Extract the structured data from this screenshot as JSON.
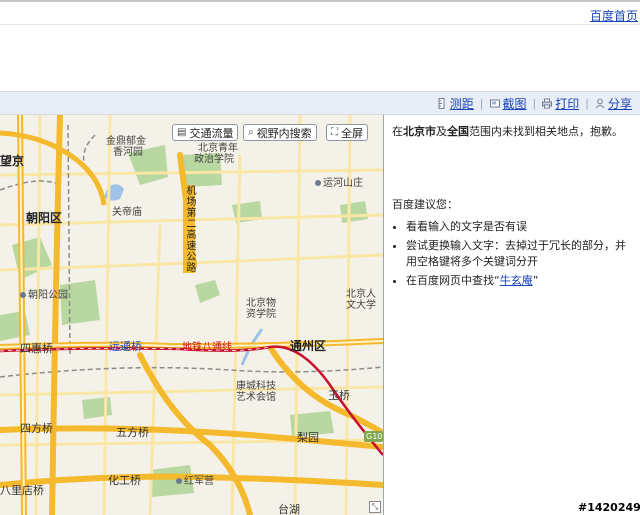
{
  "header": {
    "top_link": "百度首页"
  },
  "toolbar": {
    "items": [
      {
        "label": "测距",
        "icon": "ruler-icon"
      },
      {
        "label": "截图",
        "icon": "screenshot-icon"
      },
      {
        "label": "打印",
        "icon": "printer-icon"
      },
      {
        "label": "分享",
        "icon": "share-icon"
      }
    ],
    "separator": "|"
  },
  "map": {
    "buttons": [
      {
        "label": "交通流量",
        "icon": "traffic-icon"
      },
      {
        "label": "视野内搜索",
        "icon": "search-icon"
      },
      {
        "label": "全屏",
        "icon": "fullscreen-icon"
      }
    ],
    "labels": {
      "jing": "望京",
      "jinding": "金鼎郁金",
      "xiangheyuan": "香河园",
      "beijing_qingnian": "北京青年",
      "zhengzhi": "政治学院",
      "chaoyang": "朝阳区",
      "guandimiao": "关帝庙",
      "airport_expwy": "机场第二高速公路",
      "yunhe": "运河山庄",
      "chaoyang_park": "朝阳公园",
      "wuzi_1": "北京物",
      "wuzi_2": "资学院",
      "renmin_1": "北京人",
      "renmin_2": "文大学",
      "sihuiqiao": "四惠桥",
      "yuanyuanqiao": "远通桥",
      "batong": "地铁八通线",
      "tongzhou": "通州区",
      "kangcheng_1": "康城科技",
      "kangcheng_2": "艺术会馆",
      "yuqiao": "玉桥",
      "sifangqiao": "四方桥",
      "wufangqiao": "五方桥",
      "liyuan": "梨园",
      "huagongqiao": "化工桥",
      "hongjunying": "红军营",
      "balizhuang": "八里店桥",
      "taihu": "台湖",
      "g103": "G103"
    }
  },
  "results": {
    "not_found_pre": "在",
    "not_found_city": "北京市",
    "not_found_mid": "及",
    "not_found_scope": "全国",
    "not_found_post": "范围内未找到相关地点，抱歉。",
    "suggest_title": "百度建议您：",
    "suggestions": [
      "看看输入的文字是否有误",
      "尝试更换输入文字：去掉过于冗长的部分，并用空格键将多个关键词分开",
      "在百度网页中查找"
    ],
    "search_term": "牛玄庵",
    "quote_open": "“",
    "quote_close": "”"
  },
  "watermark": "#1420249",
  "colors": {
    "link": "#1a44b8",
    "highway": "#f4b92c",
    "road": "#fbe7a5",
    "park": "#b9d7a0",
    "water": "#9ec3e6",
    "metro": "#c8102e"
  }
}
